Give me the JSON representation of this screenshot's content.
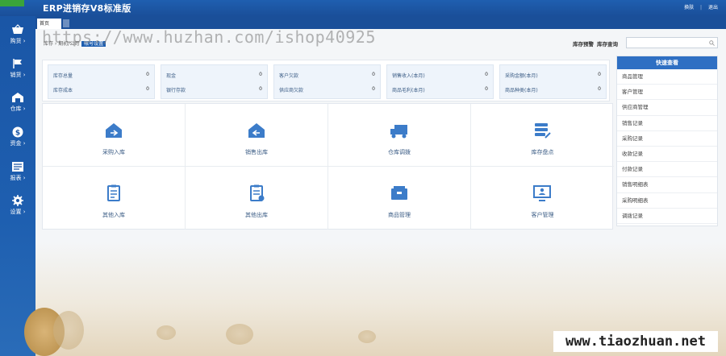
{
  "app": {
    "title": "ERP进销存V8标准版",
    "corner_badge": "",
    "top_links": [
      "换肤",
      "|",
      "退出"
    ]
  },
  "sidebar": {
    "items": [
      {
        "label": "购货 ›",
        "icon": "basket-icon"
      },
      {
        "label": "销货 ›",
        "icon": "flag-icon"
      },
      {
        "label": "仓库 ›",
        "icon": "warehouse-icon"
      },
      {
        "label": "资金 ›",
        "icon": "dollar-icon"
      },
      {
        "label": "报表 ›",
        "icon": "report-icon"
      },
      {
        "label": "设置 ›",
        "icon": "gear-icon"
      }
    ]
  },
  "tabs": [
    {
      "label": "首页"
    }
  ],
  "breadcrumb": {
    "text": "库存 › 期初/公司",
    "pill": "帐号设置"
  },
  "stock_links": {
    "warning": "库存预警",
    "query": "库存查询"
  },
  "search": {
    "placeholder": ""
  },
  "watermarks": {
    "top": "https://www.huzhan.com/ishop40925",
    "bottom": "www.tiaozhuan.net"
  },
  "stats": [
    {
      "rows": [
        {
          "label": "库存总量",
          "value": "0"
        },
        {
          "label": "库存成本",
          "value": "0"
        }
      ]
    },
    {
      "rows": [
        {
          "label": "现金",
          "value": "0"
        },
        {
          "label": "银行存款",
          "value": "0"
        }
      ]
    },
    {
      "rows": [
        {
          "label": "客户欠款",
          "value": "0"
        },
        {
          "label": "供应商欠款",
          "value": "0"
        }
      ]
    },
    {
      "rows": [
        {
          "label": "销售收入(本月)",
          "value": "0"
        },
        {
          "label": "商品毛利(本月)",
          "value": "0"
        }
      ]
    },
    {
      "rows": [
        {
          "label": "采购金额(本月)",
          "value": "0"
        },
        {
          "label": "商品种类(本月)",
          "value": "0"
        }
      ]
    }
  ],
  "shortcuts": [
    {
      "label": "采购入库",
      "icon": "house-in-icon"
    },
    {
      "label": "销售出库",
      "icon": "house-out-icon"
    },
    {
      "label": "仓库调拨",
      "icon": "truck-icon"
    },
    {
      "label": "库存盘点",
      "icon": "stack-icon"
    },
    {
      "label": "其他入库",
      "icon": "clipboard-in-icon"
    },
    {
      "label": "其他出库",
      "icon": "clipboard-out-icon"
    },
    {
      "label": "商品管理",
      "icon": "box-icon"
    },
    {
      "label": "客户管理",
      "icon": "monitor-user-icon"
    }
  ],
  "quick_view": {
    "title": "快速查看",
    "items": [
      "商品管理",
      "客户管理",
      "供应商管理",
      "销售记录",
      "采购记录",
      "收款记录",
      "付款记录",
      "销售明细表",
      "采购明细表",
      "调拨记录"
    ]
  },
  "colors": {
    "primary": "#1f5fb0",
    "accent": "#2e6fc3",
    "icon_blue": "#3c7cc9"
  }
}
